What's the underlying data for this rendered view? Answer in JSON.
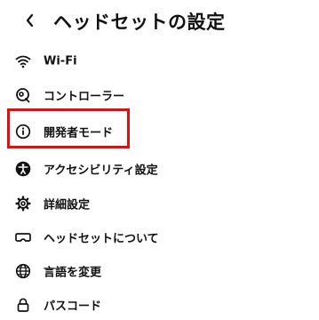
{
  "header": {
    "title": "ヘッドセットの設定",
    "back_icon": "chevron-left-icon"
  },
  "menu": {
    "items": [
      {
        "label": "Wi-Fi",
        "icon": "wifi-icon"
      },
      {
        "label": "コントローラー",
        "icon": "controller-icon"
      },
      {
        "label": "開発者モード",
        "icon": "info-icon",
        "highlighted": true
      },
      {
        "label": "アクセシビリティ設定",
        "icon": "accessibility-icon"
      },
      {
        "label": "詳細設定",
        "icon": "gear-icon"
      },
      {
        "label": "ヘッドセットについて",
        "icon": "headset-icon"
      },
      {
        "label": "言語を変更",
        "icon": "globe-icon"
      },
      {
        "label": "パスコード",
        "icon": "lock-icon"
      }
    ]
  },
  "colors": {
    "highlight": "#e01010",
    "text": "#111111",
    "background": "#ffffff"
  }
}
